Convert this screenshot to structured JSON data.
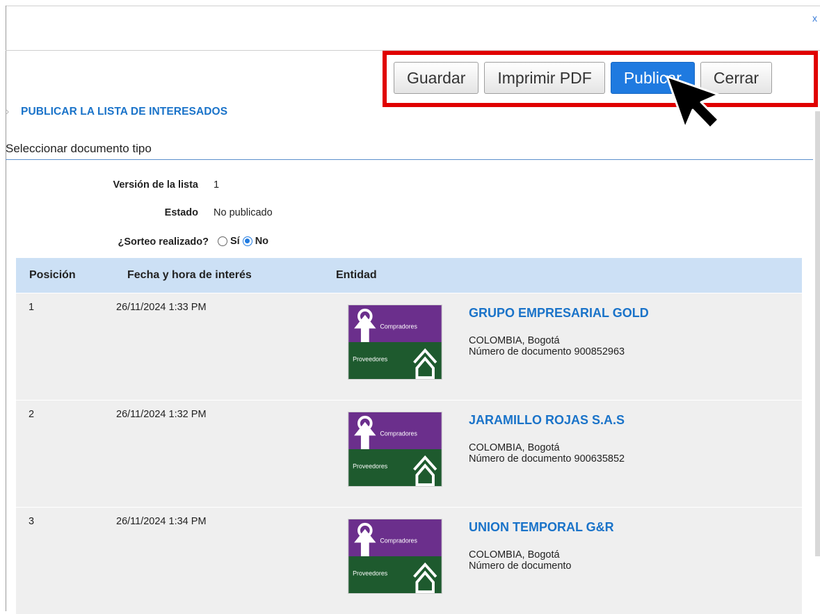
{
  "dialog": {
    "close_label": "x"
  },
  "toolbar": {
    "save_label": "Guardar",
    "print_label": "Imprimir PDF",
    "publish_label": "Publicar",
    "close_label": "Cerrar"
  },
  "section": {
    "title": "PUBLICAR LA LISTA DE INTERESADOS",
    "subtitle": "Seleccionar documento tipo"
  },
  "fields": {
    "version_label": "Versión de la lista",
    "version_value": "1",
    "status_label": "Estado",
    "status_value": "No publicado",
    "lottery_label": "¿Sorteo realizado?",
    "lottery_yes": "Sí",
    "lottery_no": "No",
    "lottery_selected": "No"
  },
  "table": {
    "headers": [
      "Posición",
      "Fecha y hora de interés",
      "Entidad"
    ],
    "rows": [
      {
        "position": "1",
        "datetime": "26/11/2024 1:33 PM",
        "entity_name": "GRUPO EMPRESARIAL GOLD",
        "location": "COLOMBIA, Bogotá",
        "document": "Número de documento 900852963"
      },
      {
        "position": "2",
        "datetime": "26/11/2024 1:32 PM",
        "entity_name": "JARAMILLO ROJAS S.A.S",
        "location": "COLOMBIA, Bogotá",
        "document": "Número de documento 900635852"
      },
      {
        "position": "3",
        "datetime": "26/11/2024 1:34 PM",
        "entity_name": "UNION TEMPORAL G&R",
        "location": "COLOMBIA, Bogotá",
        "document": "Número de documento"
      }
    ]
  },
  "logo": {
    "buyers_label": "Compradores",
    "suppliers_label": "Proveedores",
    "purple": "#6b2f8c",
    "green": "#1e5a2e"
  },
  "colors": {
    "accent": "#1a73c9",
    "primary_button": "#1f7ae0",
    "highlight": "#e00000",
    "table_header": "#cce0f5",
    "row_bg": "#efefef"
  }
}
